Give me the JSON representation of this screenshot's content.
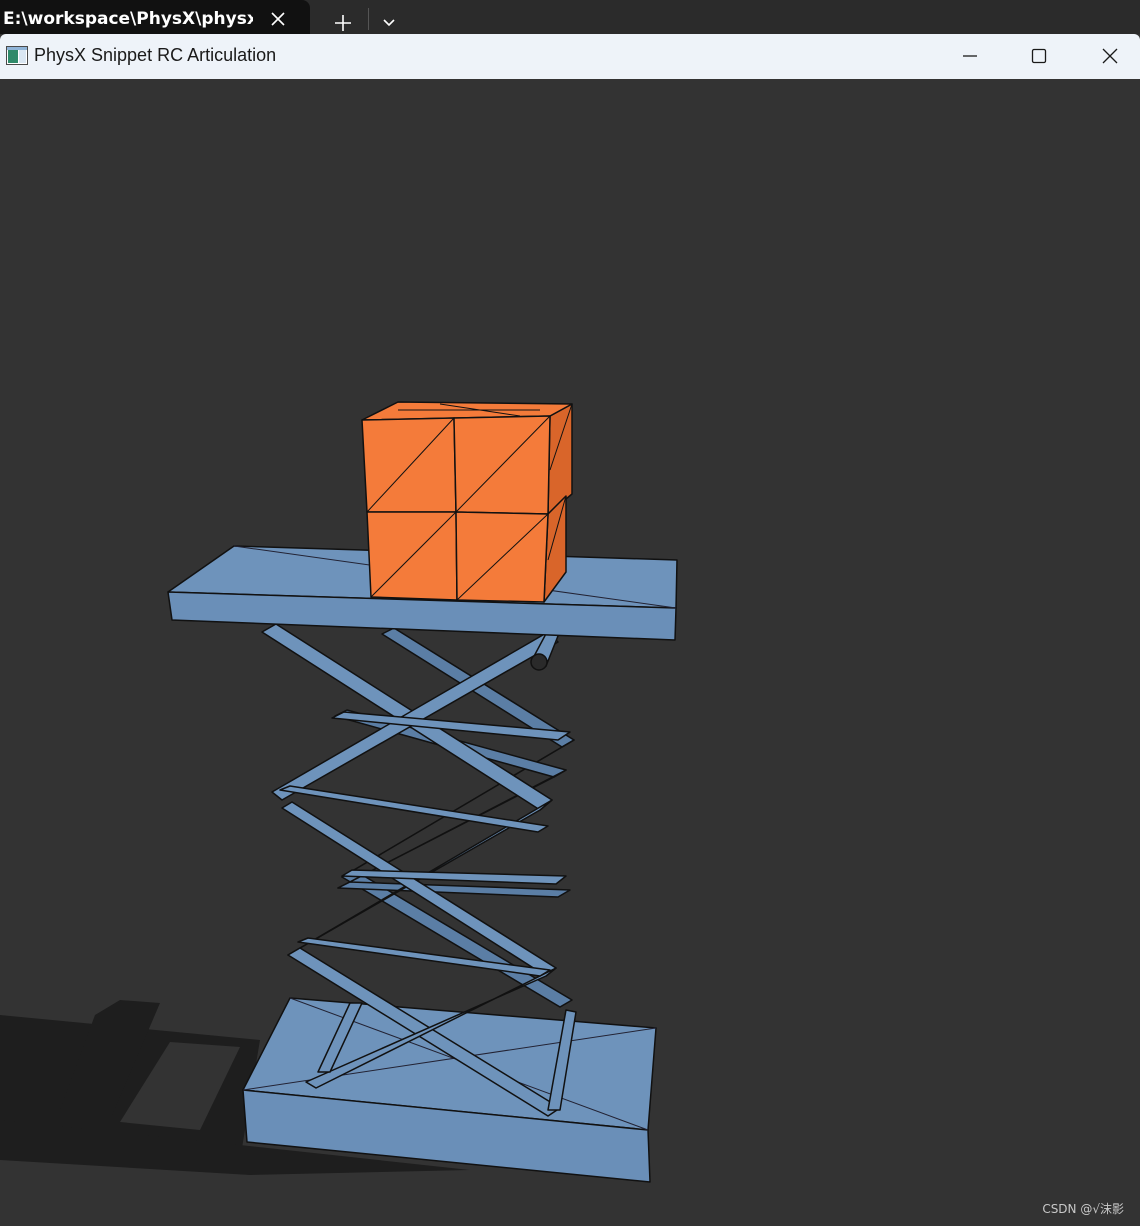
{
  "terminal_tab": {
    "title": "E:\\workspace\\PhysX\\physx\\bi",
    "close_icon": "close-icon",
    "new_tab_icon": "plus-icon",
    "dropdown_icon": "chevron-down-icon"
  },
  "window": {
    "title": "PhysX Snippet RC Articulation",
    "icon": "app-window-icon",
    "controls": [
      "minimize-icon",
      "maximize-icon",
      "close-icon"
    ]
  },
  "scene": {
    "background_color": "#333333",
    "lift_color": "#6e93bb",
    "lift_dark_color": "#5b7ea5",
    "box_color": "#f47b3a",
    "box_dark_color": "#d9652a",
    "shadow_color": "#1e1e1e"
  },
  "watermark": {
    "text": "CSDN @√沫影"
  }
}
